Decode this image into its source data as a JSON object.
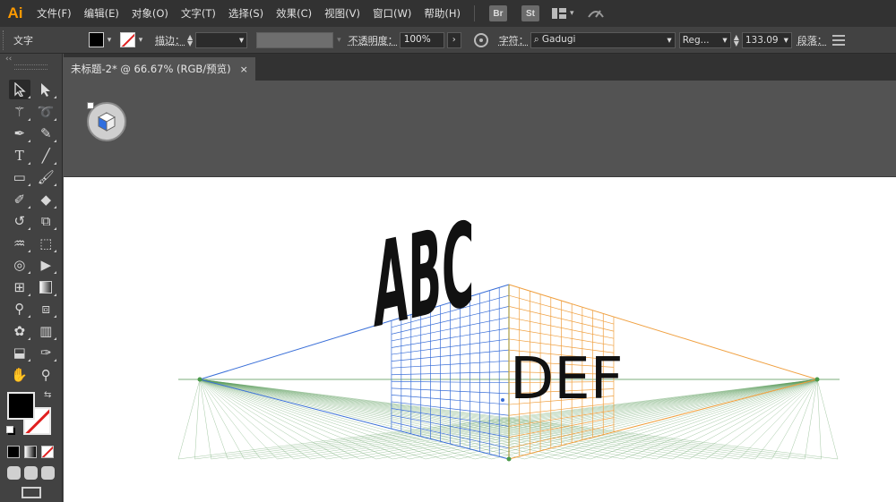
{
  "app": {
    "logo": "Ai"
  },
  "menu": {
    "items": [
      "文件(F)",
      "编辑(E)",
      "对象(O)",
      "文字(T)",
      "选择(S)",
      "效果(C)",
      "视图(V)",
      "窗口(W)",
      "帮助(H)"
    ],
    "bridge": "Br",
    "stock": "St"
  },
  "control": {
    "tool_name": "文字",
    "stroke_label": "描边",
    "opacity_label": "不透明度",
    "opacity_value": "100%",
    "char_label": "字符",
    "font_name": "Gadugi",
    "font_style": "Reg...",
    "font_size": "133.09",
    "para_label": "段落",
    "fill_color": "#000000",
    "stroke_color": "#ffffff"
  },
  "toolbar": {
    "collapse": "‹‹",
    "tools": [
      [
        "selection-tool",
        "direct-selection-tool"
      ],
      [
        "magic-wand-tool",
        "lasso-tool"
      ],
      [
        "pen-tool",
        "curvature-tool"
      ],
      [
        "type-tool",
        "line-tool"
      ],
      [
        "rectangle-tool",
        "paintbrush-tool"
      ],
      [
        "shaper-tool",
        "eraser-tool"
      ],
      [
        "rotate-tool",
        "scale-tool"
      ],
      [
        "warp-tool",
        "free-transform-tool"
      ],
      [
        "shape-builder-tool",
        "perspective-grid-tool"
      ],
      [
        "mesh-tool",
        "gradient-tool"
      ],
      [
        "eyedropper-tool",
        "blend-tool"
      ],
      [
        "symbol-sprayer-tool",
        "column-graph-tool"
      ],
      [
        "artboard-tool",
        "slice-tool"
      ],
      [
        "hand-tool",
        "zoom-tool"
      ]
    ],
    "fill_color": "#000000",
    "stroke_color": "#ffffff"
  },
  "document": {
    "tab_title": "未标题-2* @ 66.67% (RGB/预览)",
    "close": "×"
  },
  "artwork": {
    "left_text": "ABC",
    "right_text": "DEF",
    "left_grid_color": "#3a6fd8",
    "right_grid_color": "#f0a040",
    "ground_grid_color": "#5a9a5a"
  }
}
